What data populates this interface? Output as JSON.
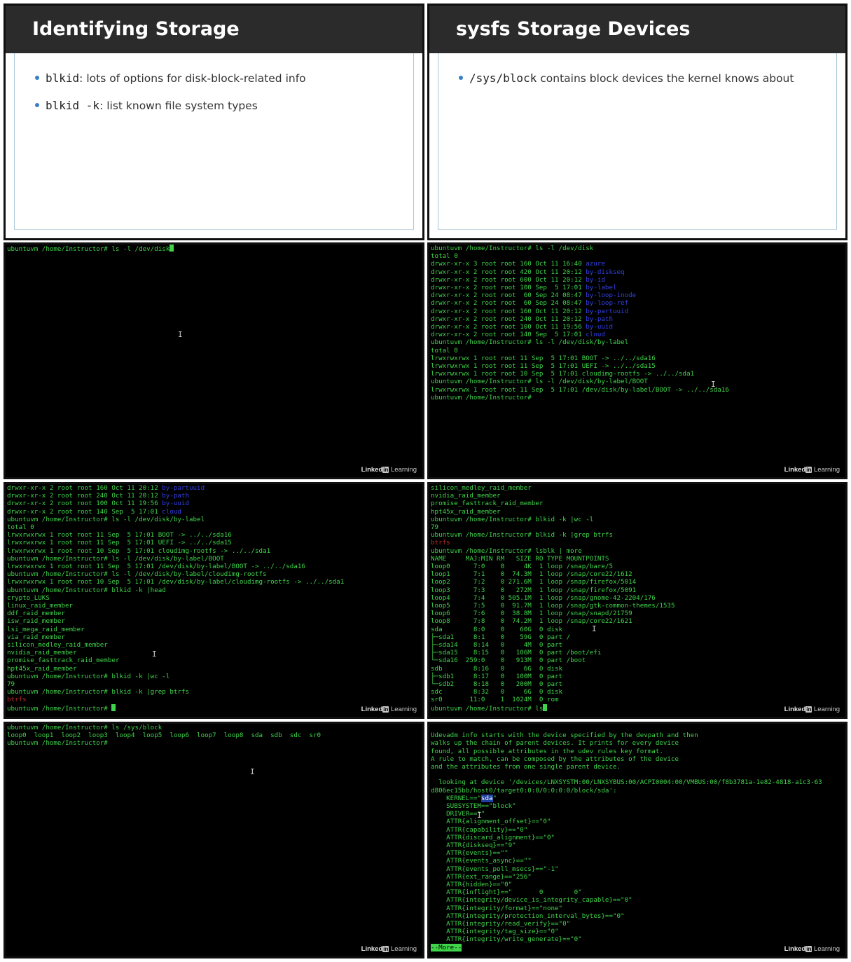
{
  "slides": {
    "left": {
      "title": "Identifying Storage",
      "bullets": [
        {
          "code": "blkid",
          "text": ": lots of options for disk-block-related info"
        },
        {
          "code": "blkid -k",
          "text": ": list known file system types"
        }
      ]
    },
    "right": {
      "title": "sysfs Storage Devices",
      "bullets": [
        {
          "code": "/sys/block",
          "text": " contains block devices the kernel knows about"
        }
      ]
    }
  },
  "brand": {
    "name": "Linked",
    "in": "in",
    "suffix": "Learning"
  },
  "terminals": {
    "t1": {
      "prompt": "ubuntuvm /home/Instructor# ",
      "command": "ls -l /dev/disk"
    },
    "t2": {
      "lines": [
        "ubuntuvm /home/Instructor# ls -l /dev/disk",
        "total 0",
        "drwxr-xr-x 3 root root 160 Oct 11 16:40 ",
        "drwxr-xr-x 2 root root 420 Oct 11 20:12 ",
        "drwxr-xr-x 2 root root 600 Oct 11 20:12 ",
        "drwxr-xr-x 2 root root 100 Sep  5 17:01 ",
        "drwxr-xr-x 2 root root  60 Sep 24 08:47 ",
        "drwxr-xr-x 2 root root  60 Sep 24 08:47 ",
        "drwxr-xr-x 2 root root 160 Oct 11 20:12 ",
        "drwxr-xr-x 2 root root 240 Oct 11 20:12 ",
        "drwxr-xr-x 2 root root 100 Oct 11 19:56 ",
        "drwxr-xr-x 2 root root 140 Sep  5 17:01 ",
        "ubuntuvm /home/Instructor# ls -l /dev/disk/by-label",
        "total 0",
        "lrwxrwxrwx 1 root root 11 Sep  5 17:01 BOOT -> ../../sda16",
        "lrwxrwxrwx 1 root root 11 Sep  5 17:01 UEFI -> ../../sda15",
        "lrwxrwxrwx 1 root root 10 Sep  5 17:01 cloudimg-rootfs -> ../../sda1",
        "ubuntuvm /home/Instructor# ls -l /dev/disk/by-label/BOOT",
        "lrwxrwxrwx 1 root root 11 Sep  5 17:01 /dev/disk/by-label/BOOT -> ../../sda16",
        "ubuntuvm /home/Instructor#"
      ],
      "dirs": [
        "azure",
        "by-diskseq",
        "by-id",
        "by-label",
        "by-loop-inode",
        "by-loop-ref",
        "by-partuuid",
        "by-path",
        "by-uuid",
        "cloud"
      ]
    },
    "t3": {
      "lines": [
        "drwxr-xr-x 2 root root 160 Oct 11 20:12 ",
        "drwxr-xr-x 2 root root 240 Oct 11 20:12 ",
        "drwxr-xr-x 2 root root 100 Oct 11 19:56 ",
        "drwxr-xr-x 2 root root 140 Sep  5 17:01 ",
        "ubuntuvm /home/Instructor# ls -l /dev/disk/by-label",
        "total 0",
        "lrwxrwxrwx 1 root root 11 Sep  5 17:01 BOOT -> ../../sda16",
        "lrwxrwxrwx 1 root root 11 Sep  5 17:01 UEFI -> ../../sda15",
        "lrwxrwxrwx 1 root root 10 Sep  5 17:01 cloudimg-rootfs -> ../../sda1",
        "ubuntuvm /home/Instructor# ls -l /dev/disk/by-label/BOOT",
        "lrwxrwxrwx 1 root root 11 Sep  5 17:01 /dev/disk/by-label/BOOT -> ../../sda16",
        "ubuntuvm /home/Instructor# ls -l /dev/disk/by-label/cloudimg-rootfs",
        "lrwxrwxrwx 1 root root 10 Sep  5 17:01 /dev/disk/by-label/cloudimg-rootfs -> ../../sda1",
        "ubuntuvm /home/Instructor# blkid -k |head",
        "crypto_LUKS",
        "linux_raid_member",
        "ddf_raid_member",
        "isw_raid_member",
        "lsi_mega_raid_member",
        "via_raid_member",
        "silicon_medley_raid_member",
        "nvidia_raid_member",
        "promise_fasttrack_raid_member",
        "hpt45x_raid_member",
        "ubuntuvm /home/Instructor# blkid -k |wc -l",
        "79",
        "ubuntuvm /home/Instructor# blkid -k |grep btrfs",
        "btrfs",
        "ubuntuvm /home/Instructor# "
      ],
      "dirs": [
        "by-partuuid",
        "by-path",
        "by-uuid",
        "cloud"
      ]
    },
    "t4": {
      "lines": [
        "silicon_medley_raid_member",
        "nvidia_raid_member",
        "promise_fasttrack_raid_member",
        "hpt45x_raid_member",
        "ubuntuvm /home/Instructor# blkid -k |wc -l",
        "79",
        "ubuntuvm /home/Instructor# blkid -k |grep btrfs",
        "btrfs",
        "ubuntuvm /home/Instructor# lsblk | more",
        "NAME     MAJ:MIN RM   SIZE RO TYPE MOUNTPOINTS",
        "loop0      7:0    0     4K  1 loop /snap/bare/5",
        "loop1      7:1    0  74.3M  1 loop /snap/core22/1612",
        "loop2      7:2    0 271.6M  1 loop /snap/firefox/5014",
        "loop3      7:3    0   272M  1 loop /snap/firefox/5091",
        "loop4      7:4    0 505.1M  1 loop /snap/gnome-42-2204/176",
        "loop5      7:5    0  91.7M  1 loop /snap/gtk-common-themes/1535",
        "loop6      7:6    0  38.8M  1 loop /snap/snapd/21759",
        "loop8      7:8    0  74.2M  1 loop /snap/core22/1621",
        "sda        8:0    0    60G  0 disk",
        "├─sda1     8:1    0    59G  0 part /",
        "├─sda14    8:14   0     4M  0 part",
        "├─sda15    8:15   0   106M  0 part /boot/efi",
        "└─sda16  259:0    0   913M  0 part /boot",
        "sdb        8:16   0     6G  0 disk",
        "├─sdb1     8:17   0   100M  0 part",
        "└─sdb2     8:18   0   200M  0 part",
        "sdc        8:32   0     6G  0 disk",
        "sr0       11:0    1  1024M  0 rom",
        "ubuntuvm /home/Instructor# ls"
      ]
    },
    "t5": {
      "lines": [
        "ubuntuvm /home/Instructor# ls /sys/block",
        "loop0  loop1  loop2  loop3  loop4  loop5  loop6  loop7  loop8  sda  sdb  sdc  sr0",
        "ubuntuvm /home/Instructor#"
      ]
    },
    "t6": {
      "lines": [
        "",
        "Udevadm info starts with the device specified by the devpath and then",
        "walks up the chain of parent devices. It prints for every device",
        "found, all possible attributes in the udev rules key format.",
        "A rule to match, can be composed by the attributes of the device",
        "and the attributes from one single parent device.",
        "",
        "  looking at device '/devices/LNXSYSTM:00/LNXSYBUS:00/ACPI0004:00/VMBUS:00/f8b3781a-1e82-4818-a1c3-63",
        "d806ec15bb/host0/target0:0:0/0:0:0:0/block/sda':",
        "    KERNEL==\"sda\"",
        "    SUBSYSTEM==\"block\"",
        "    DRIVER==\"\"",
        "    ATTR{alignment_offset}==\"0\"",
        "    ATTR{capability}==\"0\"",
        "    ATTR{discard_alignment}==\"0\"",
        "    ATTR{diskseq}==\"9\"",
        "    ATTR{events}==\"\"",
        "    ATTR{events_async}==\"\"",
        "    ATTR{events_poll_msecs}==\"-1\"",
        "    ATTR{ext_range}==\"256\"",
        "    ATTR{hidden}==\"0\"",
        "    ATTR{inflight}==\"       0        0\"",
        "    ATTR{integrity/device_is_integrity_capable}==\"0\"",
        "    ATTR{integrity/format}==\"none\"",
        "    ATTR{integrity/protection_interval_bytes}==\"0\"",
        "    ATTR{integrity/read_verify}==\"0\"",
        "    ATTR{integrity/tag_size}==\"0\"",
        "    ATTR{integrity/write_generate}==\"0\""
      ],
      "more": "--More--"
    }
  },
  "colors": {
    "terminal_green": "#3fd44a",
    "dir_blue": "#3340e0",
    "error_red": "#c22a2a",
    "header_bg": "#2b2b2b",
    "bullet": "#3a7fc1"
  }
}
